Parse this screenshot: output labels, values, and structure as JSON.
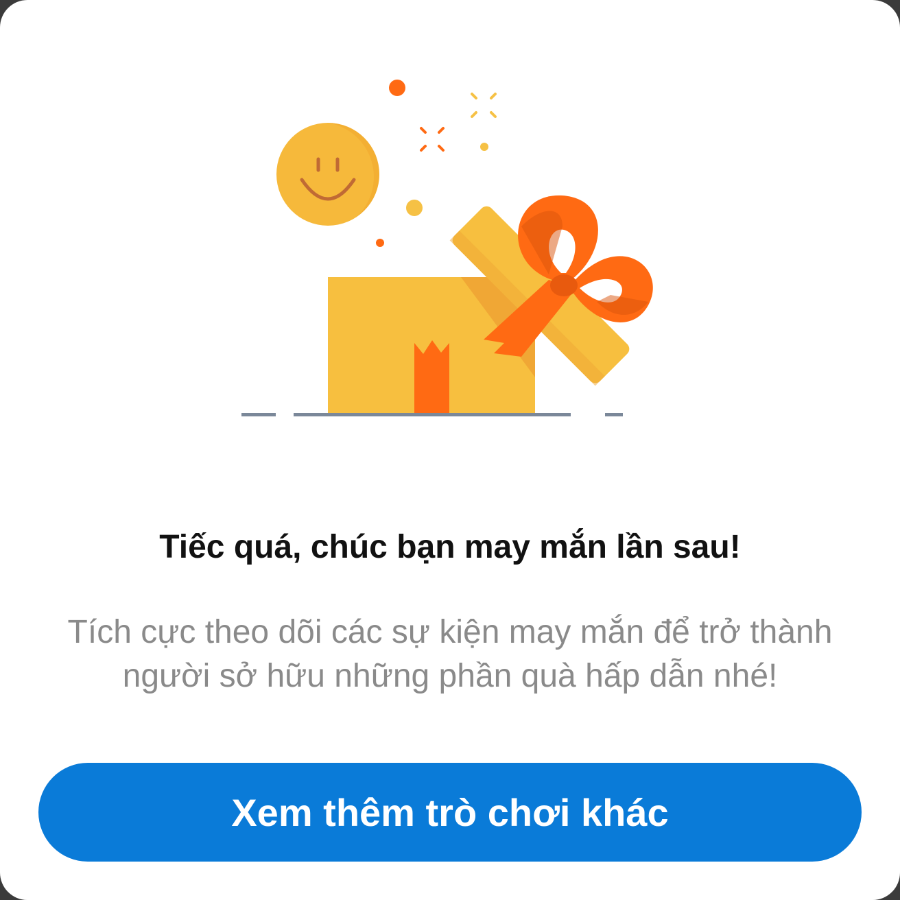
{
  "dialog": {
    "title": "Tiếc quá, chúc bạn may mắn lần sau!",
    "message": "Tích cực theo dõi các sự kiện may mắn để trở thành người sở hữu những phần quà hấp dẫn nhé!",
    "button_label": "Xem thêm trò chơi khác"
  },
  "illustration": {
    "icons": [
      "smiley-icon",
      "gift-box-icon",
      "ribbon-bow-icon",
      "confetti-icon"
    ]
  },
  "colors": {
    "accent": "#0a7bd8",
    "box": "#f7bf3f",
    "ribbon": "#ff6a13",
    "smiley": "#f6b93b",
    "ground": "#7b8899"
  }
}
